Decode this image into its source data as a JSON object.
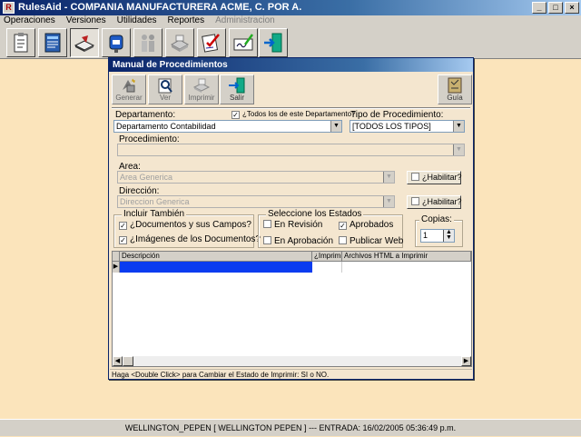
{
  "app": {
    "title": "RulesAid  - COMPANIA MANUFACTURERA ACME, C. POR A."
  },
  "menu": [
    "Operaciones",
    "Versiones",
    "Utilidades",
    "Reportes",
    "Administracion"
  ],
  "toolbar_icons": [
    "clipboard-icon",
    "document-icon",
    "book-icon",
    "mailbox-icon",
    "people-icon",
    "printer-icon",
    "checklist-icon",
    "signature-icon",
    "exit-door-icon"
  ],
  "dialog": {
    "title": "Manual de Procedimientos",
    "buttons": {
      "generar": "Generar",
      "ver": "Ver",
      "imprimir": "Imprimir",
      "salir": "Salir",
      "guia": "Guía"
    },
    "departamento_label": "Departamento:",
    "todos_label": "¿Todos los de este Departamento?",
    "departamento_value": "Departamento Contabilidad",
    "tipo_label": "Tipo de Procedimiento:",
    "tipo_value": "[TODOS LOS TIPOS]",
    "procedimiento_label": "Procedimiento:",
    "procedimiento_value": "",
    "area_label": "Area:",
    "area_value": "Area Generica",
    "habilitar_label": "¿Habilitar?",
    "direccion_label": "Dirección:",
    "direccion_value": "Direccion Generica",
    "incluir_title": "Incluir También",
    "incluir_docs": "¿Documentos y sus Campos?",
    "incluir_imgs": "¿Imágenes de los Documentos?",
    "estados_title": "Seleccione los Estados",
    "en_revision": "En Revisión",
    "aprobados": "Aprobados",
    "en_aprobacion": "En Aprobación",
    "publicar_web": "Publicar Web",
    "copias_label": "Copias:",
    "copias_value": "1",
    "grid_headers": [
      "Descripción",
      "¿Imprimir?",
      "Archivos HTML a Imprimir"
    ],
    "hint": "Haga <Double Click> para Cambiar el Estado de Imprimir: SI o NO."
  },
  "status": "WELLINGTON_PEPEN [ WELLINGTON PEPEN ] --- ENTRADA: 16/02/2005 05:36:49 p.m."
}
